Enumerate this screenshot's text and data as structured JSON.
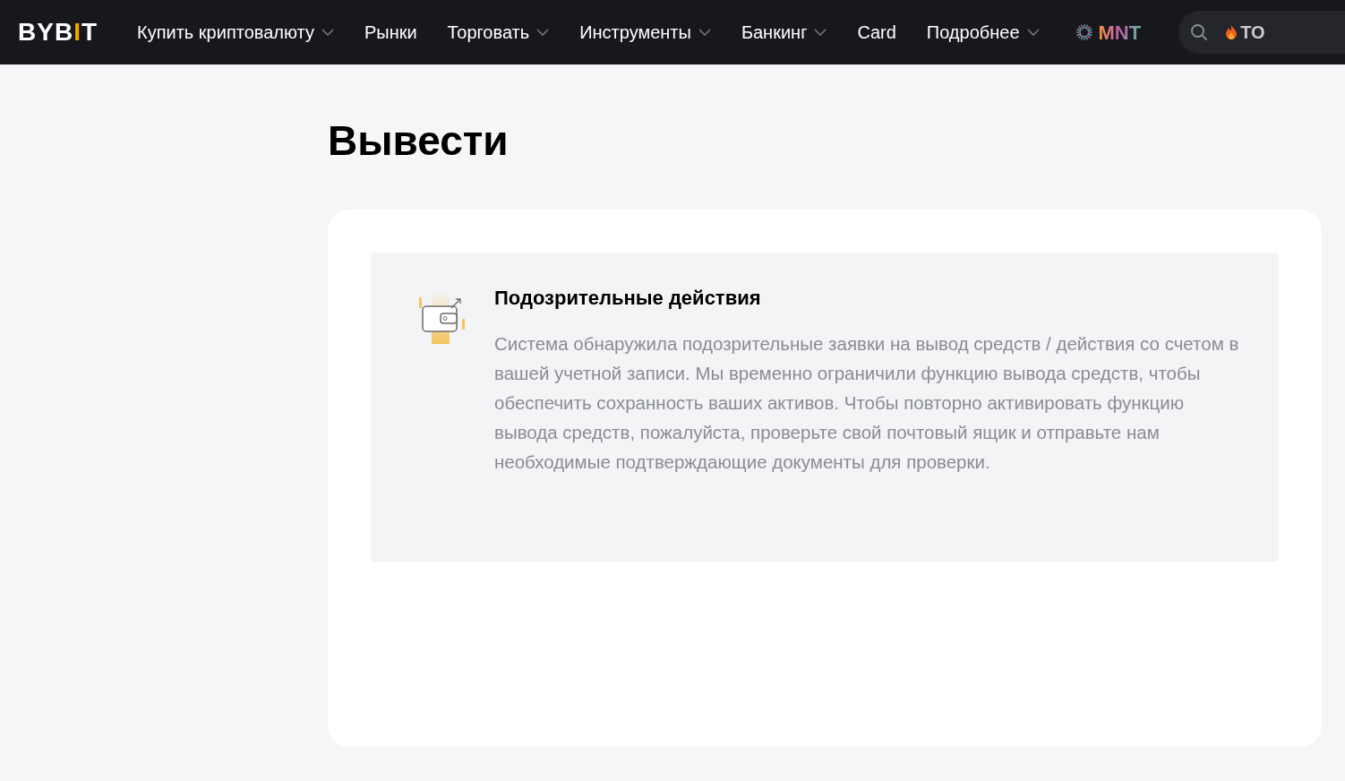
{
  "header": {
    "logo": "BYBIT",
    "nav": [
      {
        "label": "Купить криптовалюту",
        "dropdown": true
      },
      {
        "label": "Рынки",
        "dropdown": false
      },
      {
        "label": "Торговать",
        "dropdown": true
      },
      {
        "label": "Инструменты",
        "dropdown": true
      },
      {
        "label": "Банкинг",
        "dropdown": true
      },
      {
        "label": "Card",
        "dropdown": false
      },
      {
        "label": "Подробнее",
        "dropdown": true
      }
    ],
    "promo": "MNT",
    "search": {
      "text": "ТО"
    }
  },
  "page": {
    "title": "Вывести",
    "notice": {
      "title": "Подозрительные действия",
      "body": "Система обнаружила подозрительные заявки на вывод средств / действия со счетом в вашей учетной записи. Мы временно ограничили функцию вывода средств, чтобы обеспечить сохранность ваших активов. Чтобы повторно активировать функцию вывода средств, пожалуйста, проверьте свой почтовый ящик и отправьте нам необходимые подтверждающие документы для проверки."
    }
  }
}
